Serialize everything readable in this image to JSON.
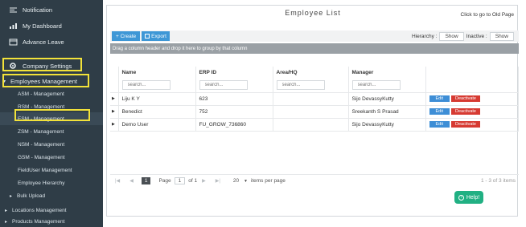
{
  "sidebar": {
    "notification": "Notification",
    "dashboard": "My Dashboard",
    "advance_leave": "Advance Leave",
    "company_settings": "Company Settings",
    "employees_management": "Employees Management",
    "children": [
      "ASM - Management",
      "RSM - Management",
      "ESM - Management",
      "ZSM - Management",
      "NSM - Management",
      "GSM - Management",
      "FieldUser Management",
      "Employee Hierarchy",
      "Bulk Upload"
    ],
    "locations_management": "Locations Management",
    "products_management": "Products Management"
  },
  "main": {
    "title": "Employee List",
    "old_page": "Click to go to Old Page",
    "create_label": "+ Create",
    "export_label": "Export",
    "hierarchy_label": "Hierarchy :",
    "hierarchy_btn": "Show",
    "inactive_label": "Inactive :",
    "inactive_btn": "Show",
    "group_hint": "Drag a column header and drop it here to group by that column",
    "columns": [
      "Name",
      "ERP ID",
      "Area/HQ",
      "Manager"
    ],
    "search_placeholder": "search...",
    "rows": [
      {
        "name": "Liju K Y",
        "erp": "623",
        "area": "",
        "manager": "Sijo DevassyKutty"
      },
      {
        "name": "Benedict",
        "erp": "752",
        "area": "",
        "manager": "Sreekanth S Prasad"
      },
      {
        "name": "Demo User",
        "erp": "FU_GROW_736860",
        "area": "",
        "manager": "Sijo DevassyKutty"
      }
    ],
    "edit_label": "Edit",
    "deactivate_label": "Deactivate",
    "pager": {
      "current": "1",
      "page_label": "Page",
      "page_value": "1",
      "of_label": "of 1",
      "per_page": "20",
      "per_page_label": "items per page",
      "info": "1 - 3 of 3 items"
    },
    "help_label": "Help!"
  }
}
